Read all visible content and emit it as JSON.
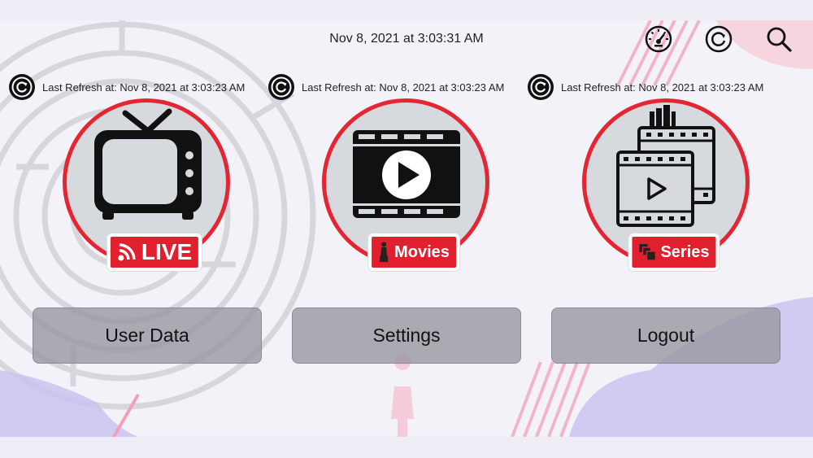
{
  "header": {
    "datetime": "Nov 8, 2021 at 3:03:31 AM",
    "icons": [
      "speedometer-icon",
      "refresh-icon",
      "search-icon"
    ]
  },
  "refresh_labels": [
    "Last Refresh at: Nov 8, 2021 at 3:03:23 AM",
    "Last Refresh at: Nov 8, 2021 at 3:03:23 AM",
    "Last Refresh at: Nov 8, 2021 at 3:03:23 AM"
  ],
  "tiles": {
    "live": {
      "label": "LIVE",
      "icon": "tv-icon"
    },
    "movies": {
      "label": "Movies",
      "icon": "film-play-icon"
    },
    "series": {
      "label": "Series",
      "icon": "series-icon"
    }
  },
  "buttons": {
    "user_data": "User Data",
    "settings": "Settings",
    "logout": "Logout"
  },
  "colors": {
    "accent_red": "#e32632",
    "circle_gray": "#d6d9dd",
    "button_gray": "#96969e"
  }
}
